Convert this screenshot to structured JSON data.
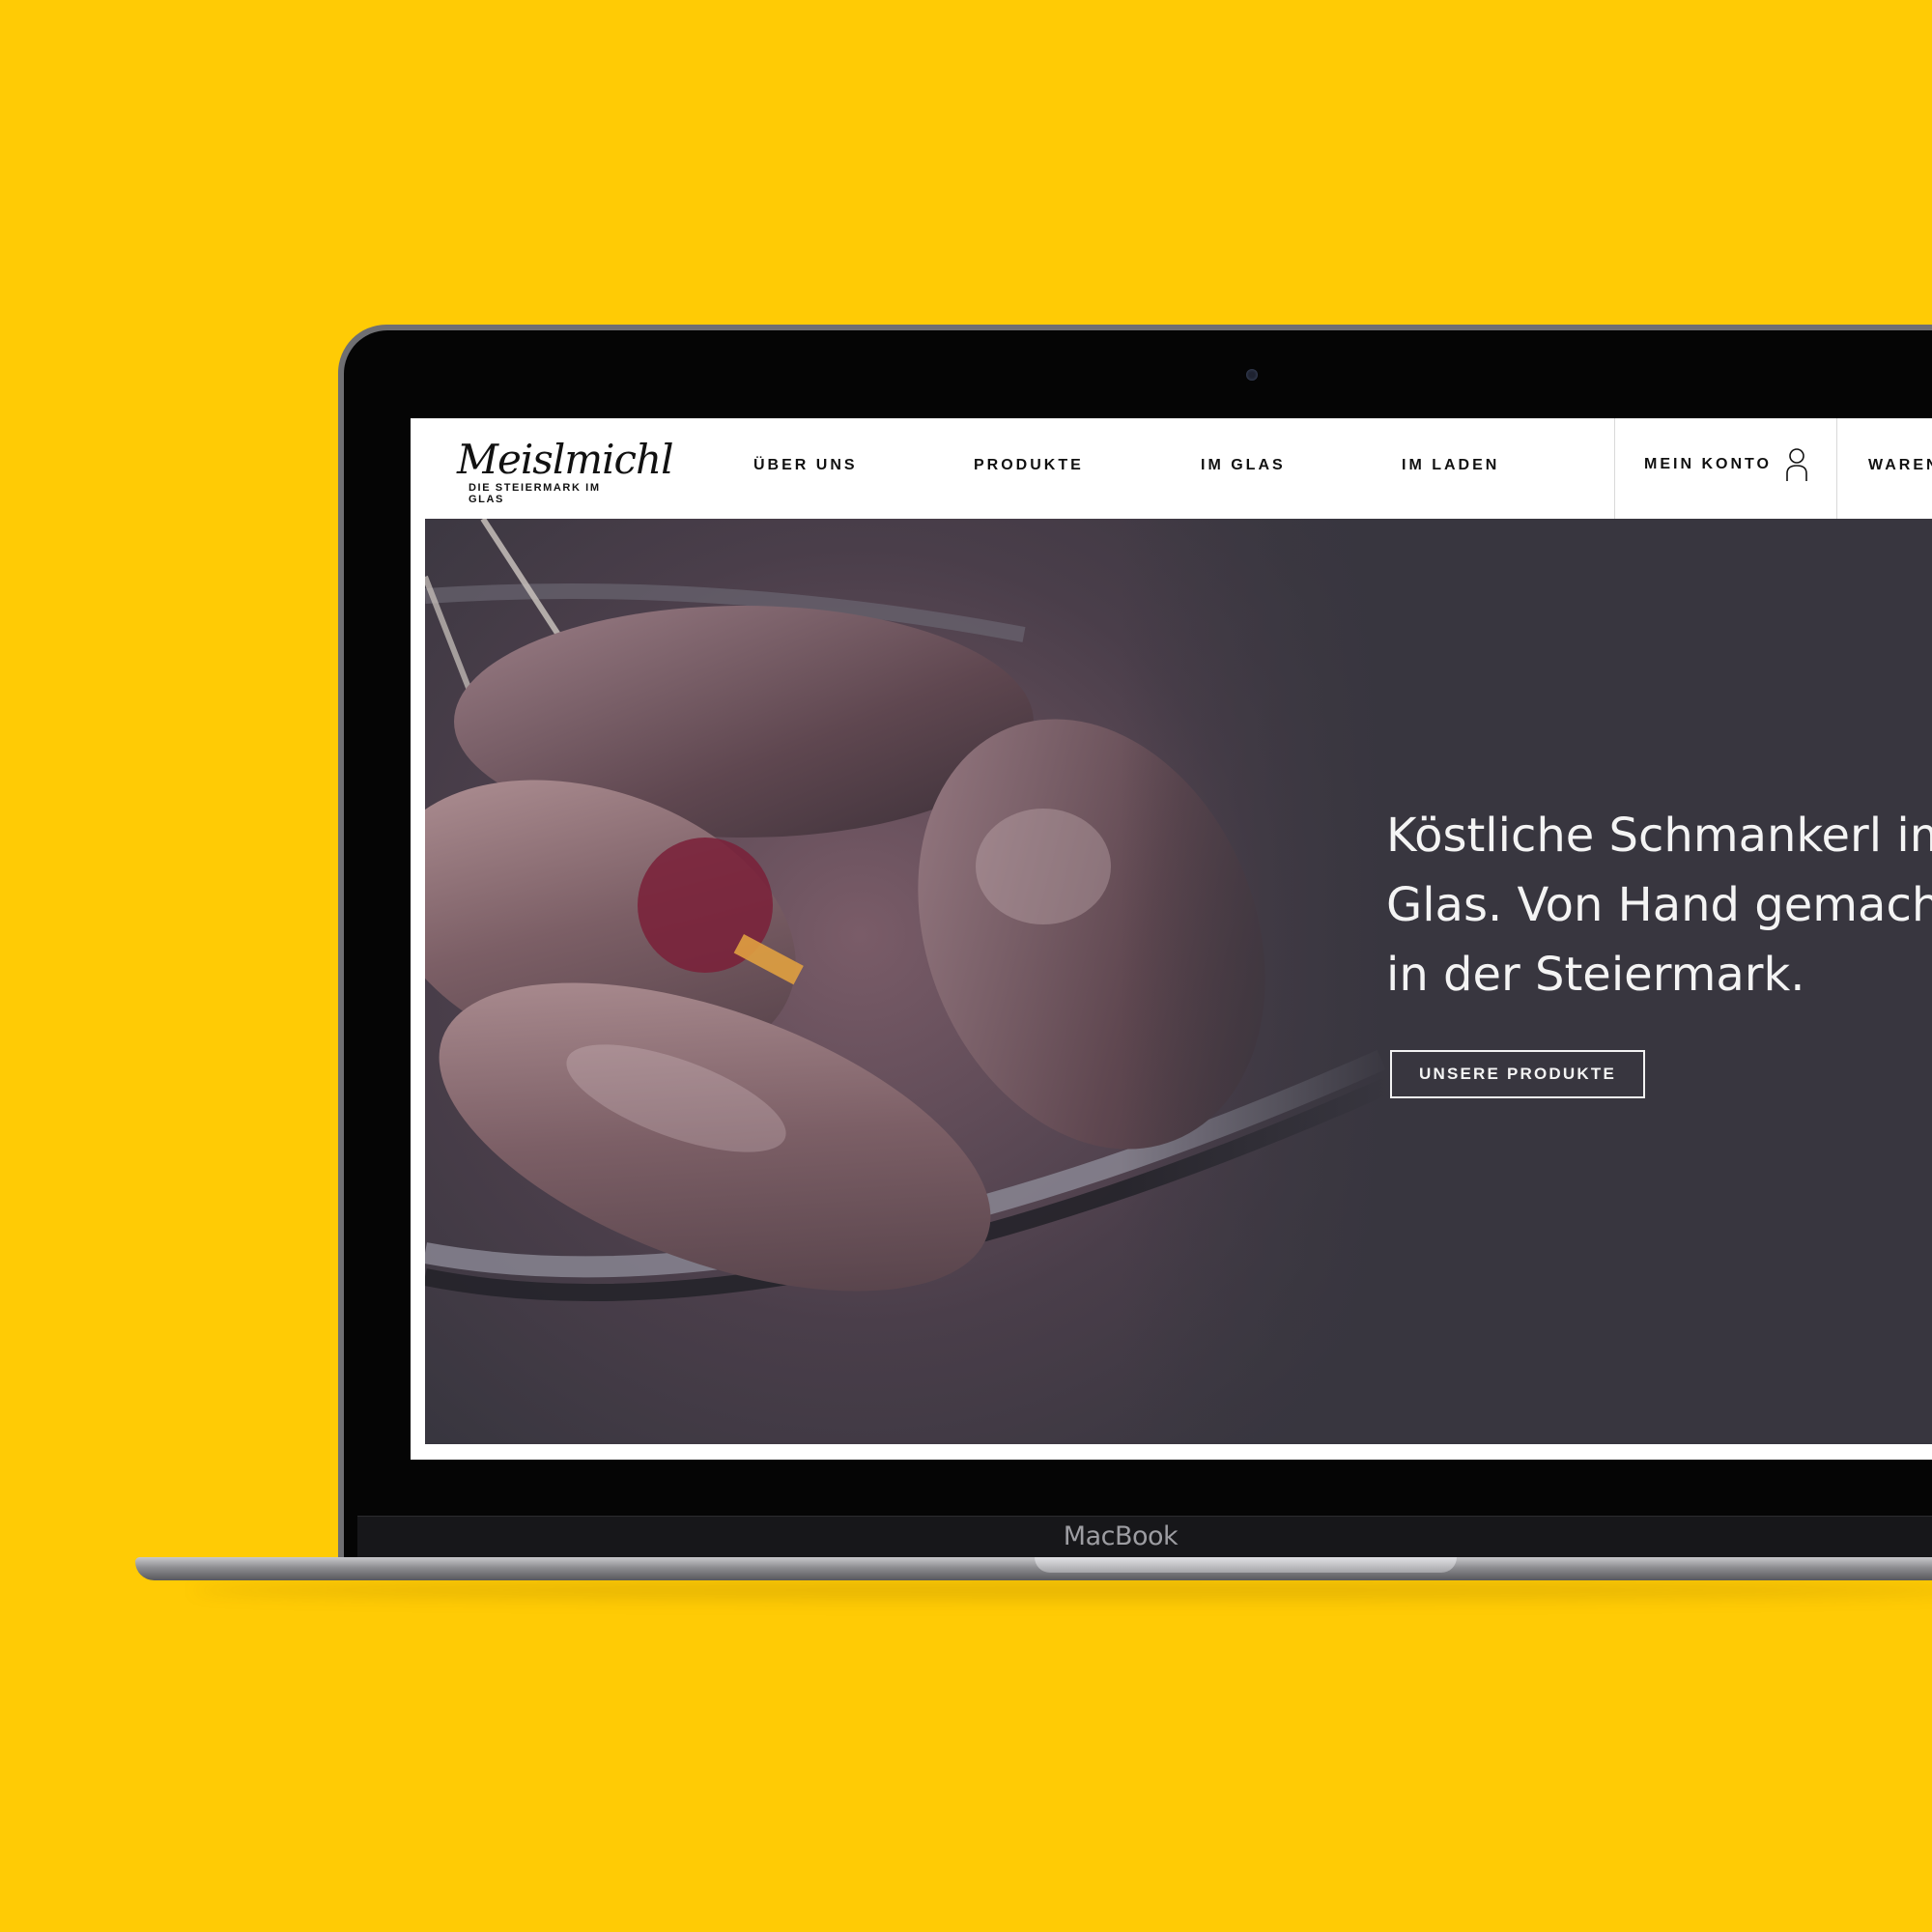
{
  "device": {
    "label": "MacBook"
  },
  "site": {
    "logo": {
      "wordmark": "Meislmichl",
      "tagline": "DIE STEIERMARK IM GLAS"
    },
    "nav": {
      "items": [
        {
          "label": "ÜBER UNS"
        },
        {
          "label": "PRODUKTE"
        },
        {
          "label": "IM GLAS"
        },
        {
          "label": "IM LADEN"
        }
      ],
      "account_label": "MEIN KONTO",
      "cart_label": "WAREN"
    },
    "hero": {
      "headline_lines": [
        "Köstliche Schmankerl im",
        "Glas. Von Hand gemacht",
        "in der Steiermark."
      ],
      "cta_label": "UNSERE PRODUKTE"
    }
  },
  "colors": {
    "background": "#ffcb05",
    "hero_background": "#38363f",
    "header_background": "#ffffff",
    "text_dark": "#111111",
    "text_light": "#f4f4f4"
  },
  "icons": {
    "account": "user-icon"
  }
}
